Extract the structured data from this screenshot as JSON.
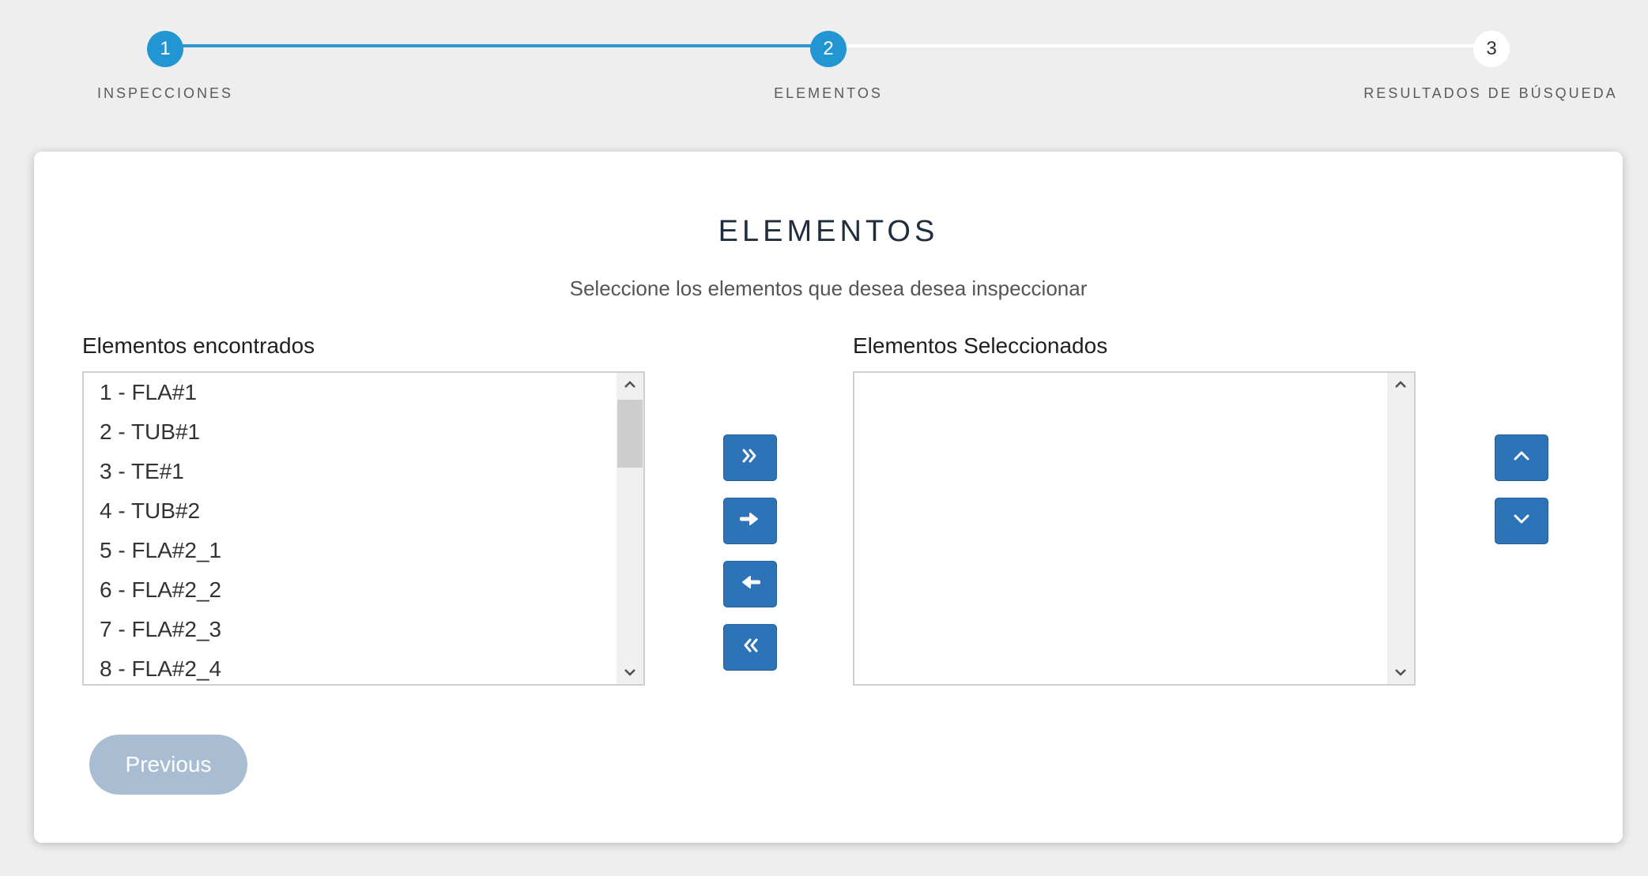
{
  "stepper": {
    "steps": [
      {
        "number": "1",
        "label": "INSPECCIONES"
      },
      {
        "number": "2",
        "label": "ELEMENTOS"
      },
      {
        "number": "3",
        "label": "RESULTADOS DE BÚSQUEDA"
      }
    ],
    "current_step": 2
  },
  "card": {
    "title": "ELEMENTOS",
    "subtitle": "Seleccione los elementos que desea desea inspeccionar"
  },
  "found_list": {
    "label": "Elementos encontrados",
    "items": [
      "1 - FLA#1",
      "2 - TUB#1",
      "3 - TE#1",
      "4 - TUB#2",
      "5 - FLA#2_1",
      "6 - FLA#2_2",
      "7 - FLA#2_3",
      "8 - FLA#2_4"
    ]
  },
  "selected_list": {
    "label": "Elementos Seleccionados",
    "items": []
  },
  "transfer_buttons": {
    "icons": [
      "double-chevron-right-icon",
      "arrow-right-icon",
      "arrow-left-icon",
      "double-chevron-left-icon"
    ]
  },
  "order_buttons": {
    "icons": [
      "chevron-up-icon",
      "chevron-down-icon"
    ]
  },
  "navigation": {
    "previous_label": "Previous"
  },
  "colors": {
    "accent": "#2196d3",
    "button": "#2d73b8",
    "previous_disabled": "#a9bdd2",
    "background": "#eeeeee"
  }
}
